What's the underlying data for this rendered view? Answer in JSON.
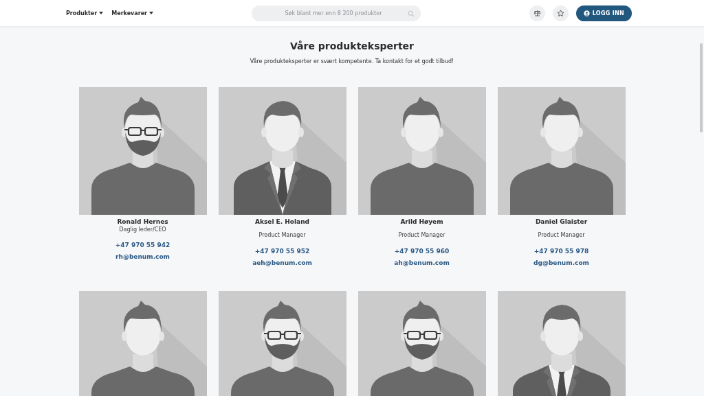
{
  "header": {
    "nav": [
      {
        "label": "Produkter"
      },
      {
        "label": "Merkevarer"
      }
    ],
    "search": {
      "placeholder": "Søk blant mer enn 8 200 produkter"
    },
    "login_button": "LOGG INN"
  },
  "heading": "Våre produkteksperter",
  "intro": "Våre produkteksperter er svært kompetente. Ta kontakt for et godt tilbud!",
  "experts": [
    {
      "avatar": {
        "kind": "tshirt",
        "glasses": true,
        "beard": true
      },
      "name": "Ronald Hernes",
      "role": "Daglig leder/CEO",
      "phone": "+47 970 55 942",
      "email": "rh@benum.com"
    },
    {
      "avatar": {
        "kind": "suit",
        "glasses": false,
        "beard": false
      },
      "name": "Aksel E. Holand",
      "role": "Product Manager",
      "phone": "+47 970 55 952",
      "email": "aeh@benum.com"
    },
    {
      "avatar": {
        "kind": "tshirt",
        "glasses": false,
        "beard": false
      },
      "name": "Arild Høyem",
      "role": "Product Manager",
      "phone": "+47 970 55 960",
      "email": "ah@benum.com"
    },
    {
      "avatar": {
        "kind": "tshirt",
        "glasses": false,
        "beard": false
      },
      "name": "Daniel Glaister",
      "role": "Product Manager",
      "phone": "+47 970 55 978",
      "email": "dg@benum.com"
    },
    {
      "avatar": {
        "kind": "tshirt",
        "glasses": false,
        "beard": false
      }
    },
    {
      "avatar": {
        "kind": "tshirt",
        "glasses": true,
        "beard": true
      }
    },
    {
      "avatar": {
        "kind": "tshirt",
        "glasses": true,
        "beard": true
      }
    },
    {
      "avatar": {
        "kind": "suit",
        "glasses": false,
        "beard": false
      }
    }
  ]
}
